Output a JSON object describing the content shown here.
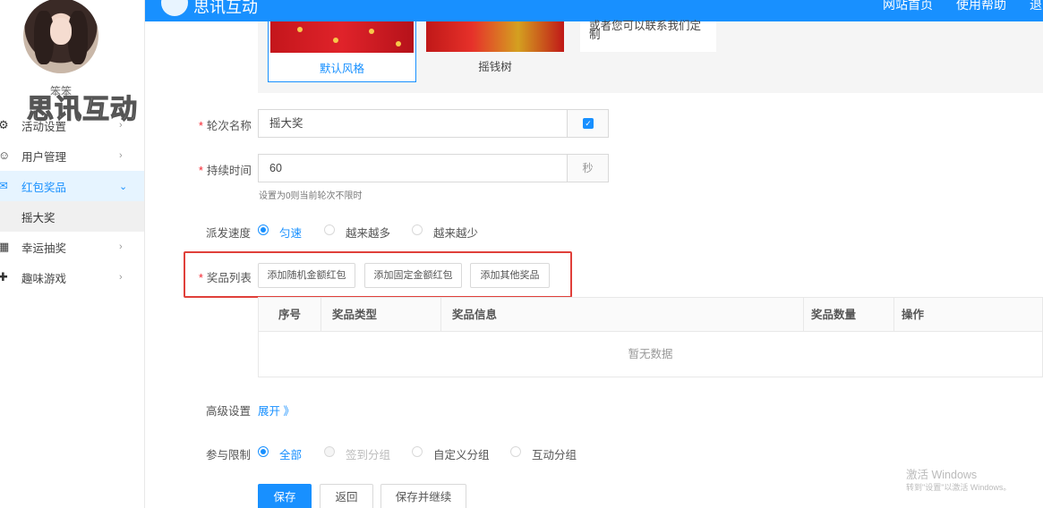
{
  "sidebar": {
    "username": "笨笨",
    "watermark": "思讯互动",
    "menu": [
      {
        "label": "活动设置",
        "icon": "gear-icon",
        "arrow": ">"
      },
      {
        "label": "用户管理",
        "icon": "user-icon",
        "arrow": ">"
      },
      {
        "label": "红包奖品",
        "icon": "gift-icon",
        "arrow": "v",
        "active": true
      },
      {
        "label": "幸运抽奖",
        "icon": "lottery-icon",
        "arrow": ">"
      },
      {
        "label": "趣味游戏",
        "icon": "game-icon",
        "arrow": ">"
      }
    ],
    "submenu": {
      "label": "摇大奖"
    }
  },
  "header": {
    "title": "思讯互动",
    "nav": [
      "网站首页",
      "使用帮助",
      "退"
    ]
  },
  "styles": {
    "default_label": "默认风格",
    "tree_label": "摇钱树",
    "note": "或者您可以联系我们定制"
  },
  "form": {
    "round_name": {
      "label": "轮次名称",
      "value": "摇大奖"
    },
    "duration": {
      "label": "持续时间",
      "value": "60",
      "unit": "秒",
      "hint": "设置为0则当前轮次不限时"
    },
    "speed": {
      "label": "派发速度",
      "options": [
        "匀速",
        "越来越多",
        "越来越少"
      ],
      "selected": "匀速"
    },
    "prizes": {
      "label": "奖品列表",
      "buttons": [
        "添加随机金额红包",
        "添加固定金额红包",
        "添加其他奖品"
      ],
      "columns": [
        "序号",
        "奖品类型",
        "奖品信息",
        "奖品数量",
        "操作"
      ],
      "empty_text": "暂无数据"
    },
    "advanced": {
      "label": "高级设置",
      "link": "展开 》"
    },
    "limit": {
      "label": "参与限制",
      "options": [
        "全部",
        "签到分组",
        "自定义分组",
        "互动分组"
      ],
      "selected": "全部"
    },
    "actions": {
      "save": "保存",
      "back": "返回",
      "save_continue": "保存并继续"
    }
  },
  "os_watermark": {
    "line1": "激活 Windows",
    "line2": "转到\"设置\"以激活 Windows。"
  },
  "colors": {
    "primary": "#1890ff",
    "highlight": "#e0403a",
    "required": "#f5222d"
  }
}
